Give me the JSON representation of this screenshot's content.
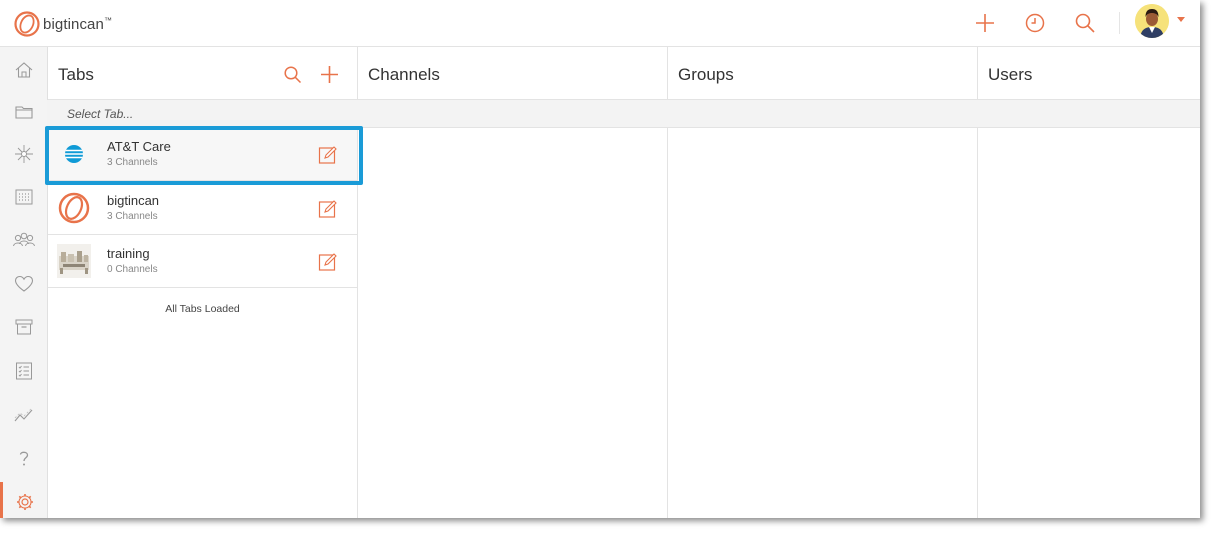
{
  "app": {
    "brand": "bigtincan",
    "brand_mark": "™",
    "accent_color": "#e8734a",
    "highlight_color": "#1a9bd7"
  },
  "topbar": {
    "icons": [
      "plus-icon",
      "clock-icon",
      "search-icon"
    ],
    "user_menu_icon": "caret-down-icon"
  },
  "sidebar": {
    "items": [
      {
        "icon": "home-icon"
      },
      {
        "icon": "folder-icon"
      },
      {
        "icon": "compass-icon"
      },
      {
        "icon": "calendar-icon"
      },
      {
        "icon": "people-icon"
      },
      {
        "icon": "heart-icon"
      },
      {
        "icon": "archive-icon"
      },
      {
        "icon": "checklist-icon"
      },
      {
        "icon": "analytics-icon"
      },
      {
        "icon": "help-icon"
      },
      {
        "icon": "gear-icon",
        "active": true
      }
    ]
  },
  "columns": {
    "tabs": "Tabs",
    "channels": "Channels",
    "groups": "Groups",
    "users": "Users"
  },
  "select_prompt": "Select Tab...",
  "tabs": [
    {
      "name": "AT&T Care",
      "subtitle": "3 Channels",
      "thumb": "att-logo"
    },
    {
      "name": "bigtincan",
      "subtitle": "3 Channels",
      "thumb": "bigtincan-logo"
    },
    {
      "name": "training",
      "subtitle": "0 Channels",
      "thumb": "training-photo"
    }
  ],
  "status": "All Tabs Loaded"
}
